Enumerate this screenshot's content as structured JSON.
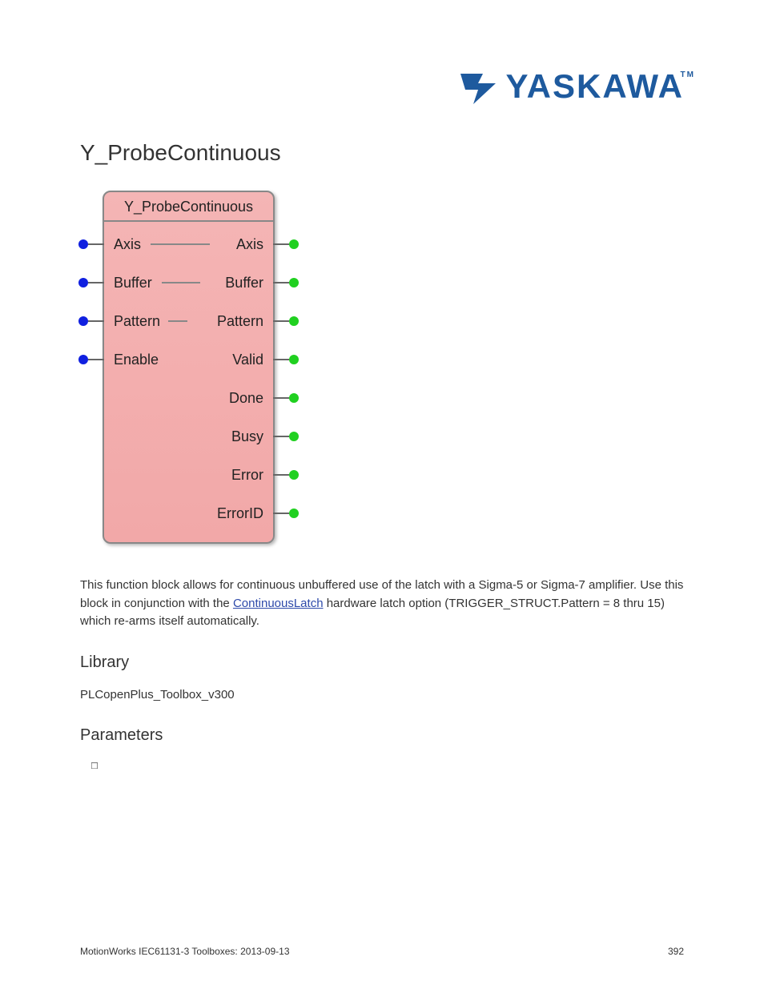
{
  "logo": {
    "text": "YASKAWA",
    "tm": "TM"
  },
  "title": "Y_ProbeContinuous",
  "block": {
    "title": "Y_ProbeContinuous",
    "rows": [
      {
        "left": "Axis",
        "right": "Axis",
        "hasInput": true,
        "hasOutput": true,
        "hasMidLine": true
      },
      {
        "left": "Buffer",
        "right": "Buffer",
        "hasInput": true,
        "hasOutput": true,
        "hasMidLine": true
      },
      {
        "left": "Pattern",
        "right": "Pattern",
        "hasInput": true,
        "hasOutput": true,
        "hasMidLine": true
      },
      {
        "left": "Enable",
        "right": "Valid",
        "hasInput": true,
        "hasOutput": true,
        "hasMidLine": false
      },
      {
        "left": "",
        "right": "Done",
        "hasInput": false,
        "hasOutput": true,
        "hasMidLine": false
      },
      {
        "left": "",
        "right": "Busy",
        "hasInput": false,
        "hasOutput": true,
        "hasMidLine": false
      },
      {
        "left": "",
        "right": "Error",
        "hasInput": false,
        "hasOutput": true,
        "hasMidLine": false
      },
      {
        "left": "",
        "right": "ErrorID",
        "hasInput": false,
        "hasOutput": true,
        "hasMidLine": false
      }
    ]
  },
  "description": {
    "text1": "This function block allows for continuous unbuffered use of the latch with a Sigma-5 or Sigma-7 amplifier. Use this block in conjunction with the ",
    "link": "ContinuousLatch",
    "text2": " hardware latch option (TRIGGER_STRUCT.Pattern = 8 thru 15) which re-arms itself automatically."
  },
  "library_heading": "Library",
  "library_text": "PLCopenPlus_Toolbox_v300",
  "parameters_heading": "Parameters",
  "footer": {
    "left": "MotionWorks IEC61131-3 Toolboxes: 2013-09-13",
    "right": "392"
  }
}
